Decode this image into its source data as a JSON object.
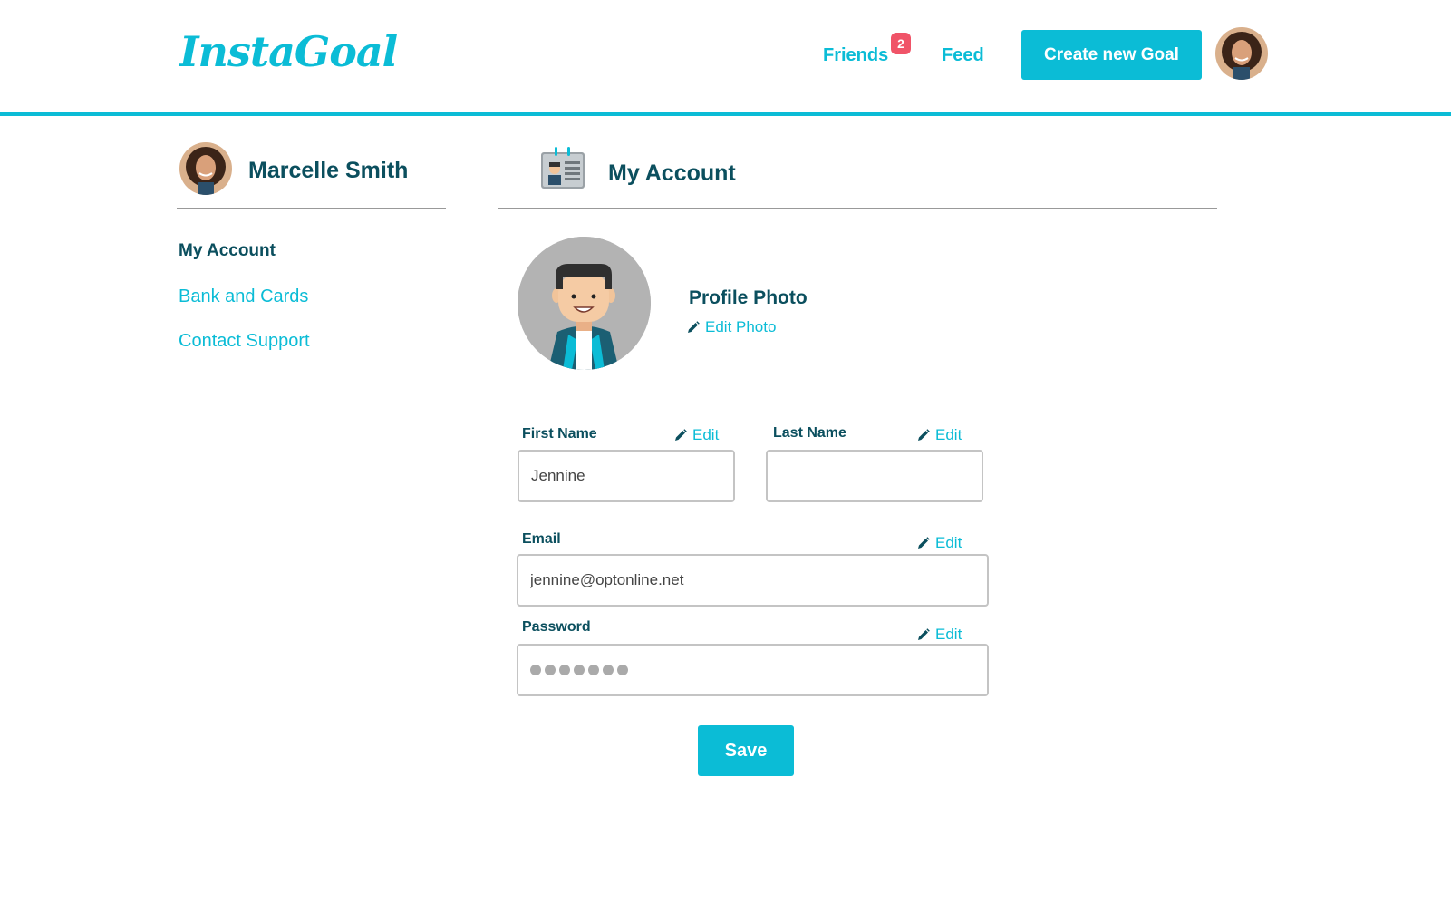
{
  "header": {
    "logo": "InstaGoal",
    "nav": {
      "friends_label": "Friends",
      "friends_badge": "2",
      "feed_label": "Feed"
    },
    "create_button": "Create new Goal"
  },
  "sidebar": {
    "user_name": "Marcelle Smith",
    "items": [
      {
        "label": "My Account",
        "active": true
      },
      {
        "label": "Bank and Cards",
        "active": false
      },
      {
        "label": "Contact Support",
        "active": false
      }
    ]
  },
  "main": {
    "title": "My Account",
    "profile_photo": {
      "label": "Profile Photo",
      "edit_label": "Edit Photo"
    },
    "fields": {
      "first_name": {
        "label": "First Name",
        "value": "Jennine",
        "edit_label": "Edit"
      },
      "last_name": {
        "label": "Last Name",
        "value": "",
        "edit_label": "Edit"
      },
      "email": {
        "label": "Email",
        "value": "jennine@optonline.net",
        "edit_label": "Edit"
      },
      "password": {
        "label": "Password",
        "masked_length": 7,
        "edit_label": "Edit"
      }
    },
    "save_button": "Save"
  },
  "colors": {
    "accent": "#0bbcd6",
    "heading": "#0b4f5e",
    "badge": "#f05468",
    "input_border": "#c4c4c4"
  },
  "icons": {
    "pencil": "pencil-icon",
    "id_card": "id-card-icon",
    "avatar": "avatar-icon"
  }
}
